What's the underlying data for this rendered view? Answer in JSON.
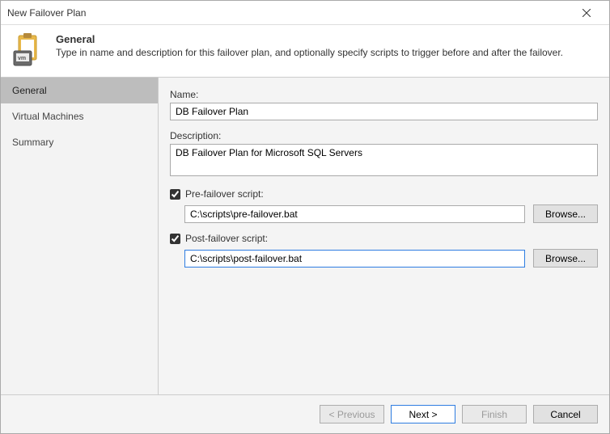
{
  "window": {
    "title": "New Failover Plan"
  },
  "header": {
    "title": "General",
    "description": "Type in name and description for this failover plan, and optionally specify scripts to trigger before and after the failover."
  },
  "sidebar": {
    "items": [
      {
        "label": "General",
        "active": true
      },
      {
        "label": "Virtual Machines",
        "active": false
      },
      {
        "label": "Summary",
        "active": false
      }
    ]
  },
  "form": {
    "name_label": "Name:",
    "name_value": "DB Failover Plan",
    "description_label": "Description:",
    "description_value": "DB Failover Plan for Microsoft SQL Servers",
    "pre_script": {
      "checkbox_label": "Pre-failover script:",
      "checked": true,
      "path": "C:\\scripts\\pre-failover.bat",
      "browse_label": "Browse..."
    },
    "post_script": {
      "checkbox_label": "Post-failover script:",
      "checked": true,
      "path": "C:\\scripts\\post-failover.bat",
      "browse_label": "Browse..."
    }
  },
  "footer": {
    "previous": "< Previous",
    "next": "Next >",
    "finish": "Finish",
    "cancel": "Cancel"
  }
}
